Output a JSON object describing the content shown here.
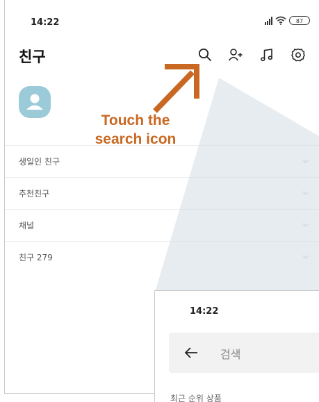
{
  "status_bar": {
    "time": "14:22",
    "battery": "87"
  },
  "header": {
    "title": "친구",
    "icons": [
      "search-icon",
      "add-friend-icon",
      "music-icon",
      "settings-icon"
    ]
  },
  "friend_sections": [
    {
      "label": "생일인 친구"
    },
    {
      "label": "추천친구"
    },
    {
      "label": "채널"
    },
    {
      "label": "친구 279"
    }
  ],
  "annotation": {
    "line1": "Touch the",
    "line2": "search icon",
    "color": "#c96822"
  },
  "inset": {
    "time": "14:22",
    "search_label": "검색",
    "cut_text": "최근 순위 상품"
  },
  "colors": {
    "avatar": "#9bcbd8",
    "accent": "#c96822"
  }
}
